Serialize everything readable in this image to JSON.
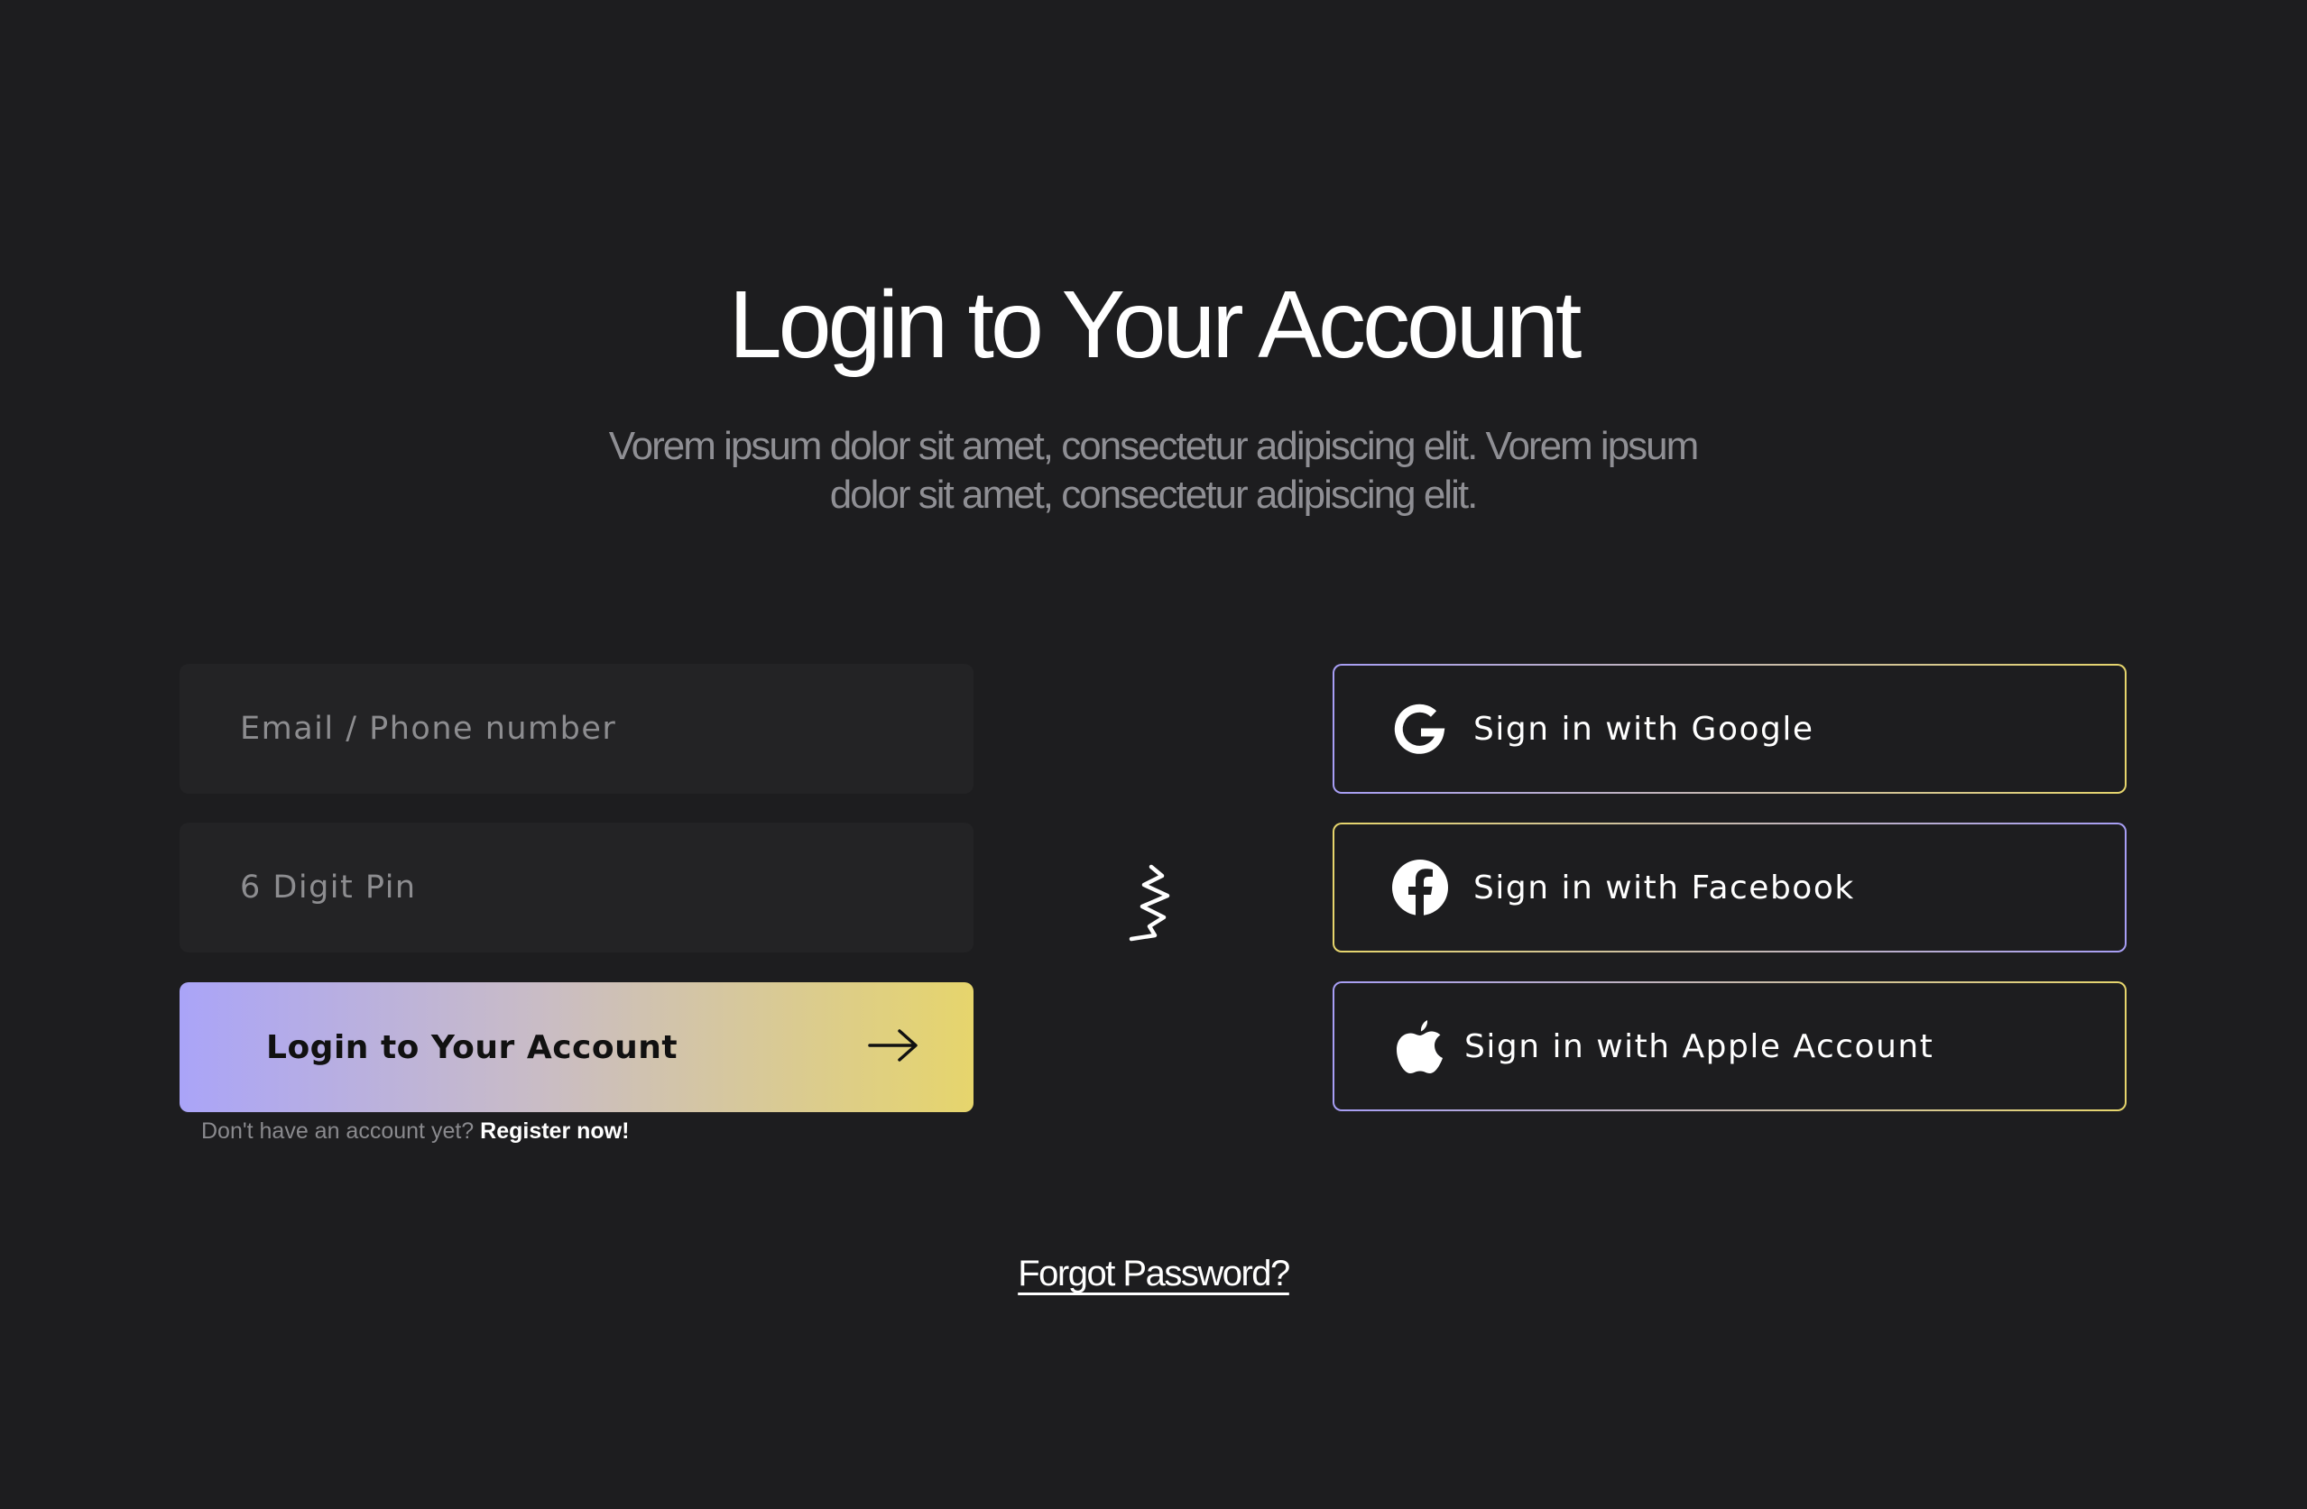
{
  "header": {
    "title": "Login to Your Account",
    "subtitle": "Vorem ipsum dolor sit amet, consectetur adipiscing elit. Vorem ipsum dolor sit amet, consectetur adipiscing elit."
  },
  "form": {
    "email_placeholder": "Email / Phone number",
    "email_value": "",
    "pin_placeholder": "6 Digit Pin",
    "pin_value": "",
    "login_label": "Login to Your Account",
    "login_icon": "arrow-right-icon",
    "register_prompt": "Don't have an account yet?",
    "register_link": "Register now!"
  },
  "divider": {
    "icon": "squiggle-icon"
  },
  "social": {
    "google": {
      "label": "Sign in with Google",
      "icon": "google-icon"
    },
    "facebook": {
      "label": "Sign in with Facebook",
      "icon": "facebook-icon"
    },
    "apple": {
      "label": "Sign in with Apple Account",
      "icon": "apple-icon"
    }
  },
  "footer": {
    "forgot_password": "Forgot Password?"
  },
  "colors": {
    "background": "#1d1d1f",
    "field_background": "#232325",
    "gradient_start": "#aaa4f8",
    "gradient_end": "#e6d56c",
    "muted_text": "#8f8f94"
  }
}
